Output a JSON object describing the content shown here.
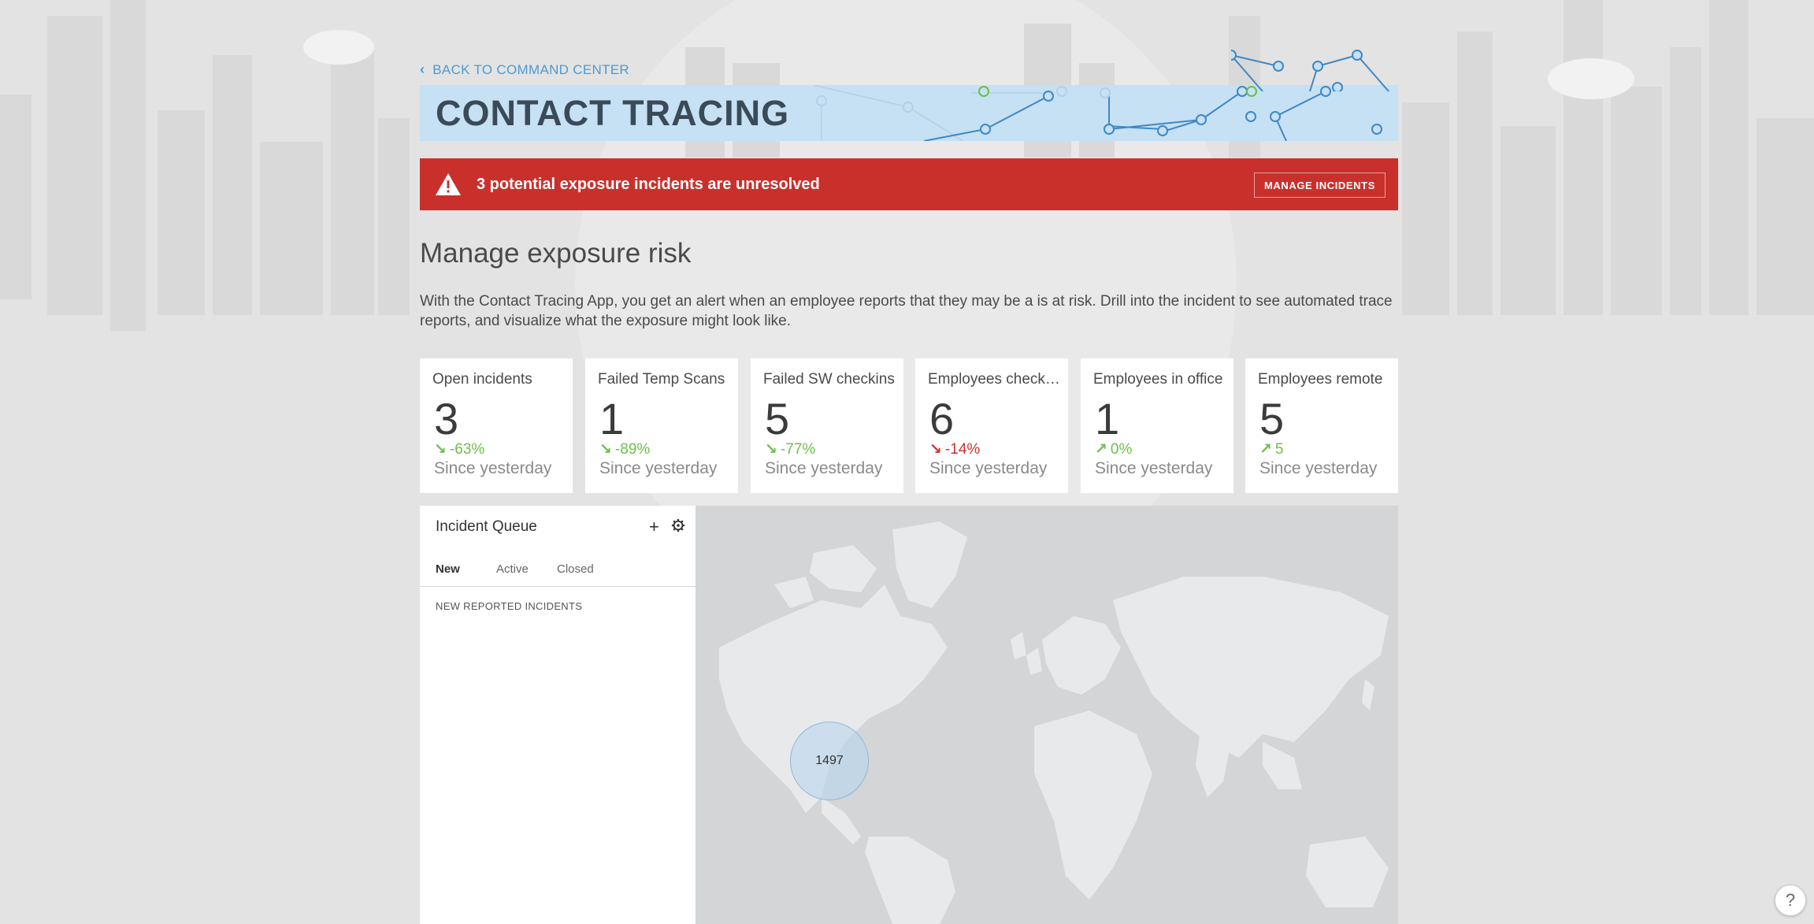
{
  "nav": {
    "back_label": "BACK TO COMMAND CENTER"
  },
  "banner": {
    "title": "CONTACT TRACING"
  },
  "alert": {
    "message": "3 potential exposure incidents are unresolved",
    "button_label": "MANAGE INCIDENTS",
    "color": "#c9302c"
  },
  "section": {
    "title": "Manage exposure risk",
    "description": "With the Contact Tracing App, you get an alert when an employee reports that they may be a is at risk. Drill into the incident to see automated trace reports, and visualize what the exposure might look like."
  },
  "cards": [
    {
      "label": "Open incidents",
      "value": "3",
      "delta": "-63%",
      "trend": "down",
      "status": "green",
      "since": "Since yesterday"
    },
    {
      "label": "Failed Temp Scans",
      "value": "1",
      "delta": "-89%",
      "trend": "down",
      "status": "green",
      "since": "Since yesterday"
    },
    {
      "label": "Failed SW checkins",
      "value": "5",
      "delta": "-77%",
      "trend": "down",
      "status": "green",
      "since": "Since yesterday"
    },
    {
      "label": "Employees checked in",
      "value": "6",
      "delta": "-14%",
      "trend": "down",
      "status": "red",
      "since": "Since yesterday"
    },
    {
      "label": "Employees in office",
      "value": "1",
      "delta": "0%",
      "trend": "up",
      "status": "green",
      "since": "Since yesterday"
    },
    {
      "label": "Employees remote",
      "value": "5",
      "delta": "5",
      "trend": "up",
      "status": "green",
      "since": "Since yesterday"
    }
  ],
  "queue": {
    "title": "Incident Queue",
    "add_icon": "+",
    "tabs": [
      "New",
      "Active",
      "Closed"
    ],
    "active_tab": "New",
    "section_label": "NEW REPORTED INCIDENTS"
  },
  "map": {
    "cluster_count": "1497"
  },
  "help": {
    "label": "?"
  },
  "colors": {
    "accent": "#4b9ad6",
    "positive": "#6cbf4b",
    "negative": "#d0312d",
    "banner": "#c6e0f4"
  }
}
